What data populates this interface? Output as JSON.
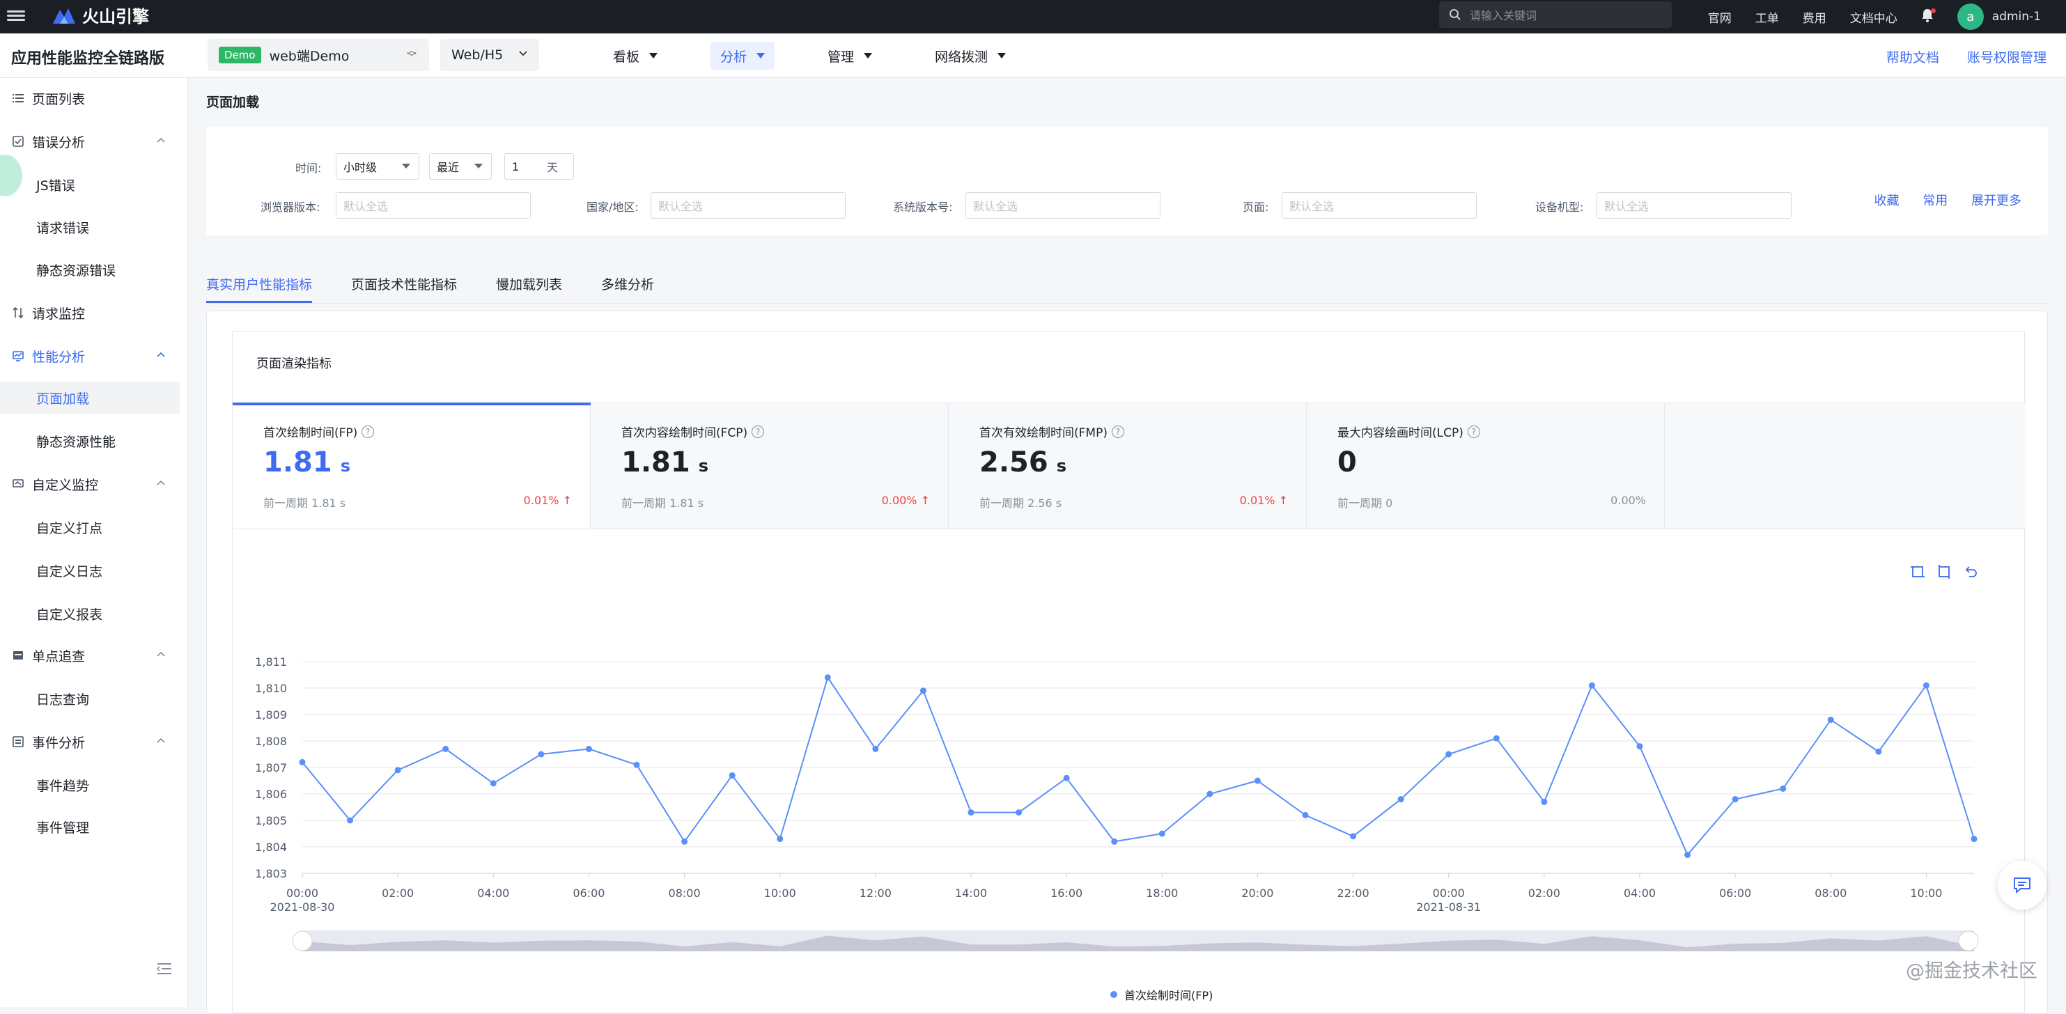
{
  "topbar": {
    "logo_text": "火山引擎",
    "search_placeholder": "请输入关键词",
    "links": [
      "官网",
      "工单",
      "费用",
      "文档中心"
    ],
    "avatar_letter": "a",
    "username": "admin-1"
  },
  "subbar": {
    "app_name": "应用性能监控全链路版",
    "app_badge": "Demo",
    "app_value": "web端Demo",
    "platform": "Web/H5",
    "menus": [
      {
        "label": "看板"
      },
      {
        "label": "分析"
      },
      {
        "label": "管理"
      },
      {
        "label": "网络拨测"
      }
    ],
    "right_links": [
      "帮助文档",
      "账号权限管理"
    ]
  },
  "sidebar": {
    "items": [
      {
        "label": "页面列表",
        "icon": "list-icon"
      },
      {
        "label": "错误分析",
        "icon": "error-icon"
      },
      {
        "label": "JS错误"
      },
      {
        "label": "请求错误"
      },
      {
        "label": "静态资源错误"
      },
      {
        "label": "请求监控",
        "icon": "request-icon"
      },
      {
        "label": "性能分析",
        "icon": "performance-icon"
      },
      {
        "label": "页面加载"
      },
      {
        "label": "静态资源性能"
      },
      {
        "label": "自定义监控",
        "icon": "custom-icon"
      },
      {
        "label": "自定义打点"
      },
      {
        "label": "自定义日志"
      },
      {
        "label": "自定义报表"
      },
      {
        "label": "单点追查",
        "icon": "trace-icon"
      },
      {
        "label": "日志查询"
      },
      {
        "label": "事件分析",
        "icon": "event-icon"
      },
      {
        "label": "事件趋势"
      },
      {
        "label": "事件管理"
      }
    ]
  },
  "page": {
    "title": "页面加载"
  },
  "filters": {
    "time_label": "时间:",
    "granularity": "小时级",
    "range_mode": "最近",
    "range_value": "1",
    "range_unit": "天",
    "browser_label": "浏览器版本:",
    "region_label": "国家/地区:",
    "os_label": "系统版本号:",
    "page_label": "页面:",
    "device_label": "设备机型:",
    "placeholder": "默认全选",
    "actions": [
      "收藏",
      "常用",
      "展开更多"
    ]
  },
  "tabs": [
    "真实用户性能指标",
    "页面技术性能指标",
    "慢加载列表",
    "多维分析"
  ],
  "section_title": "页面渲染指标",
  "metrics": [
    {
      "name": "首次绘制时间(FP)",
      "value": "1.81",
      "unit": "s",
      "prev": "前一周期 1.81 s",
      "change": "0.01%",
      "dir": "↑"
    },
    {
      "name": "首次内容绘制时间(FCP)",
      "value": "1.81",
      "unit": "s",
      "prev": "前一周期 1.81 s",
      "change": "0.00%",
      "dir": "↑"
    },
    {
      "name": "首次有效绘制时间(FMP)",
      "value": "2.56",
      "unit": "s",
      "prev": "前一周期 2.56 s",
      "change": "0.01%",
      "dir": "↑"
    },
    {
      "name": "最大内容绘画时间(LCP)",
      "value": "0",
      "unit": "",
      "prev": "前一周期 0",
      "change": "0.00%",
      "dir": ""
    }
  ],
  "chart_data": {
    "type": "line",
    "series": [
      {
        "name": "首次绘制时间(FP)",
        "values": [
          1807.2,
          1805.0,
          1806.9,
          1807.7,
          1806.4,
          1807.5,
          1807.7,
          1807.1,
          1804.2,
          1806.7,
          1804.3,
          1810.4,
          1807.7,
          1809.9,
          1805.3,
          1805.3,
          1806.6,
          1804.2,
          1804.5,
          1806.0,
          1806.5,
          1805.2,
          1804.4,
          1805.8,
          1807.5,
          1808.1,
          1805.7,
          1810.1,
          1807.8,
          1803.7,
          1805.8,
          1806.2,
          1808.8,
          1807.6,
          1810.1,
          1804.3
        ]
      }
    ],
    "x_tick_labels": [
      "00:00",
      "02:00",
      "04:00",
      "06:00",
      "08:00",
      "10:00",
      "12:00",
      "14:00",
      "16:00",
      "18:00",
      "20:00",
      "22:00",
      "00:00",
      "02:00",
      "04:00",
      "06:00",
      "08:00",
      "10:00"
    ],
    "date_labels": [
      "2021-08-30",
      "2021-08-31"
    ],
    "y_ticks": [
      1803,
      1804,
      1805,
      1806,
      1807,
      1808,
      1809,
      1810,
      1811
    ],
    "ylim": [
      1803,
      1811
    ],
    "color": "#5b8ff9",
    "grid": true,
    "legend_position": "bottom"
  },
  "watermark": "@掘金技术社区"
}
